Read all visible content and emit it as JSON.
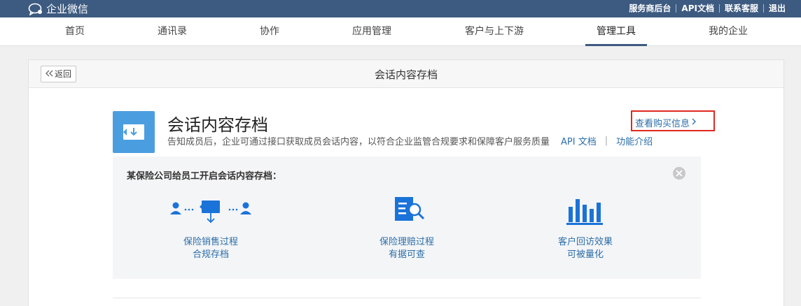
{
  "topbar": {
    "brand": "企业微信",
    "links": [
      "服务商后台",
      "API文档",
      "联系客服",
      "退出"
    ]
  },
  "nav": {
    "items": [
      "首页",
      "通讯录",
      "协作",
      "应用管理",
      "客户与上下游",
      "管理工具",
      "我的企业"
    ],
    "active": "管理工具"
  },
  "panel": {
    "back_label": "返回",
    "title": "会话内容存档"
  },
  "app": {
    "title": "会话内容存档",
    "description": "告知成员后，企业可通过接口获取成员会话内容，以符合企业监管合规要求和保障客户服务质量",
    "api_doc": "API 文档",
    "separator": "|",
    "feature_intro": "功能介绍",
    "buy_info": "查看购买信息"
  },
  "case": {
    "title": "某保险公司给员工开启会话内容存档：",
    "features": [
      {
        "line1": "保险销售过程",
        "line2": "合规存档"
      },
      {
        "line1": "保险理赔过程",
        "line2": "有据可查"
      },
      {
        "line1": "客户回访效果",
        "line2": "可被量化"
      }
    ]
  },
  "colors": {
    "topbar": "#3d5a80",
    "icon_blue": "#4a9ee0",
    "link": "#2b6ea8",
    "highlight": "#e0281e"
  }
}
